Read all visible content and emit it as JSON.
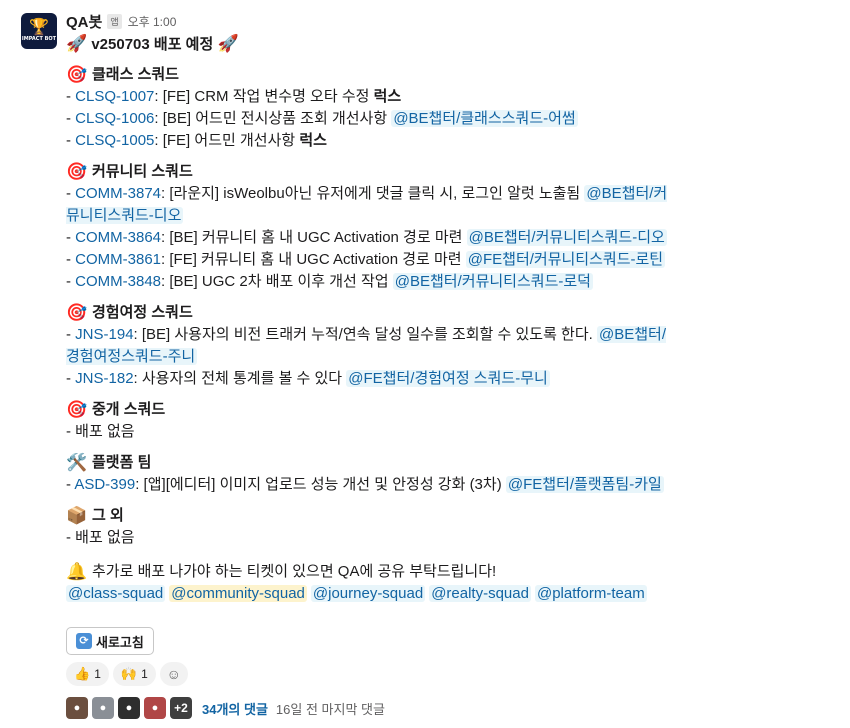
{
  "message": {
    "sender": "QA봇",
    "app_badge": "앱",
    "time": "오후 1:00",
    "avatar_brand": "IMPACT BOT",
    "title": "v250703 배포 예정"
  },
  "sections": [
    {
      "emoji": "🎯",
      "title": "클래스 스쿼드",
      "items": [
        {
          "prefix": "- ",
          "ticket": "CLSQ-1007",
          "text": ": [FE] CRM 작업 변수명 오타 수정 ",
          "strong": "럭스",
          "mention": ""
        },
        {
          "prefix": "- ",
          "ticket": "CLSQ-1006",
          "text": ": [BE] 어드민 전시상품 조회 개선사항 ",
          "strong": "",
          "mention": "@BE챕터/클래스스쿼드-어썸"
        },
        {
          "prefix": "- ",
          "ticket": "CLSQ-1005",
          "text": ": [FE] 어드민 개선사항 ",
          "strong": "럭스",
          "mention": ""
        }
      ]
    },
    {
      "emoji": "🎯",
      "title": "커뮤니티 스쿼드",
      "items": [
        {
          "prefix": "- ",
          "ticket": "COMM-3874",
          "text": ": [라운지] isWeolbu아닌 유저에게 댓글 클릭 시, 로그인 알럿 노출됨 ",
          "strong": "",
          "mention": "@BE챕터/커뮤니티스쿼드-디오"
        },
        {
          "prefix": "- ",
          "ticket": "COMM-3864",
          "text": ": [BE] 커뮤니티 홈 내 UGC Activation 경로 마련 ",
          "strong": "",
          "mention": "@BE챕터/커뮤니티스쿼드-디오"
        },
        {
          "prefix": "- ",
          "ticket": "COMM-3861",
          "text": ": [FE] 커뮤니티 홈 내 UGC Activation 경로 마련 ",
          "strong": "",
          "mention": "@FE챕터/커뮤니티스쿼드-로틴"
        },
        {
          "prefix": "- ",
          "ticket": "COMM-3848",
          "text": ": [BE] UGC 2차 배포 이후 개선 작업 ",
          "strong": "",
          "mention": "@BE챕터/커뮤니티스쿼드-로덕"
        }
      ]
    },
    {
      "emoji": "🎯",
      "title": "경험여정 스쿼드",
      "items": [
        {
          "prefix": "- ",
          "ticket": "JNS-194",
          "text": ": [BE] 사용자의 비전 트래커 누적/연속 달성 일수를 조회할 수 있도록 한다. ",
          "strong": "",
          "mention": "@BE챕터/경험여정스쿼드-주니"
        },
        {
          "prefix": "- ",
          "ticket": "JNS-182",
          "text": ": 사용자의 전체 통계를 볼 수 있다 ",
          "strong": "",
          "mention": "@FE챕터/경험여정 스쿼드-무니"
        }
      ]
    },
    {
      "emoji": "🎯",
      "title": "중개 스쿼드",
      "items": [
        {
          "prefix": "- ",
          "ticket": "",
          "text": "배포 없음",
          "strong": "",
          "mention": ""
        }
      ]
    },
    {
      "emoji": "🛠️",
      "title": "플랫폼 팀",
      "items": [
        {
          "prefix": "- ",
          "ticket": "ASD-399",
          "text": ": [앱][에디터] 이미지 업로드 성능 개선 및 안정성 강화 (3차) ",
          "strong": "",
          "mention": "@FE챕터/플랫폼팀-카일"
        }
      ]
    },
    {
      "emoji": "📦",
      "title": "그 외",
      "items": [
        {
          "prefix": "- ",
          "ticket": "",
          "text": "배포 없음",
          "strong": "",
          "mention": ""
        }
      ]
    }
  ],
  "footer": {
    "note": "추가로 배포 나가야 하는 티켓이 있으면 QA에 공유 부탁드립니다!",
    "group_mentions": [
      "@class-squad",
      "@community-squad",
      "@journey-squad",
      "@realty-squad",
      "@platform-team"
    ],
    "highlighted_group": "@community-squad"
  },
  "refresh_button": "새로고침",
  "reactions": [
    {
      "emoji": "👍",
      "count": "1"
    },
    {
      "emoji": "🙌",
      "count": "1"
    }
  ],
  "thread": {
    "more_count": "+2",
    "reply_count": "34개의 댓글",
    "last_reply": "16일 전 마지막 댓글"
  },
  "colors": {
    "link": "#1264a3",
    "mention_bg": "#e8f5fa",
    "mention_highlight_bg": "#fdf3cd"
  }
}
